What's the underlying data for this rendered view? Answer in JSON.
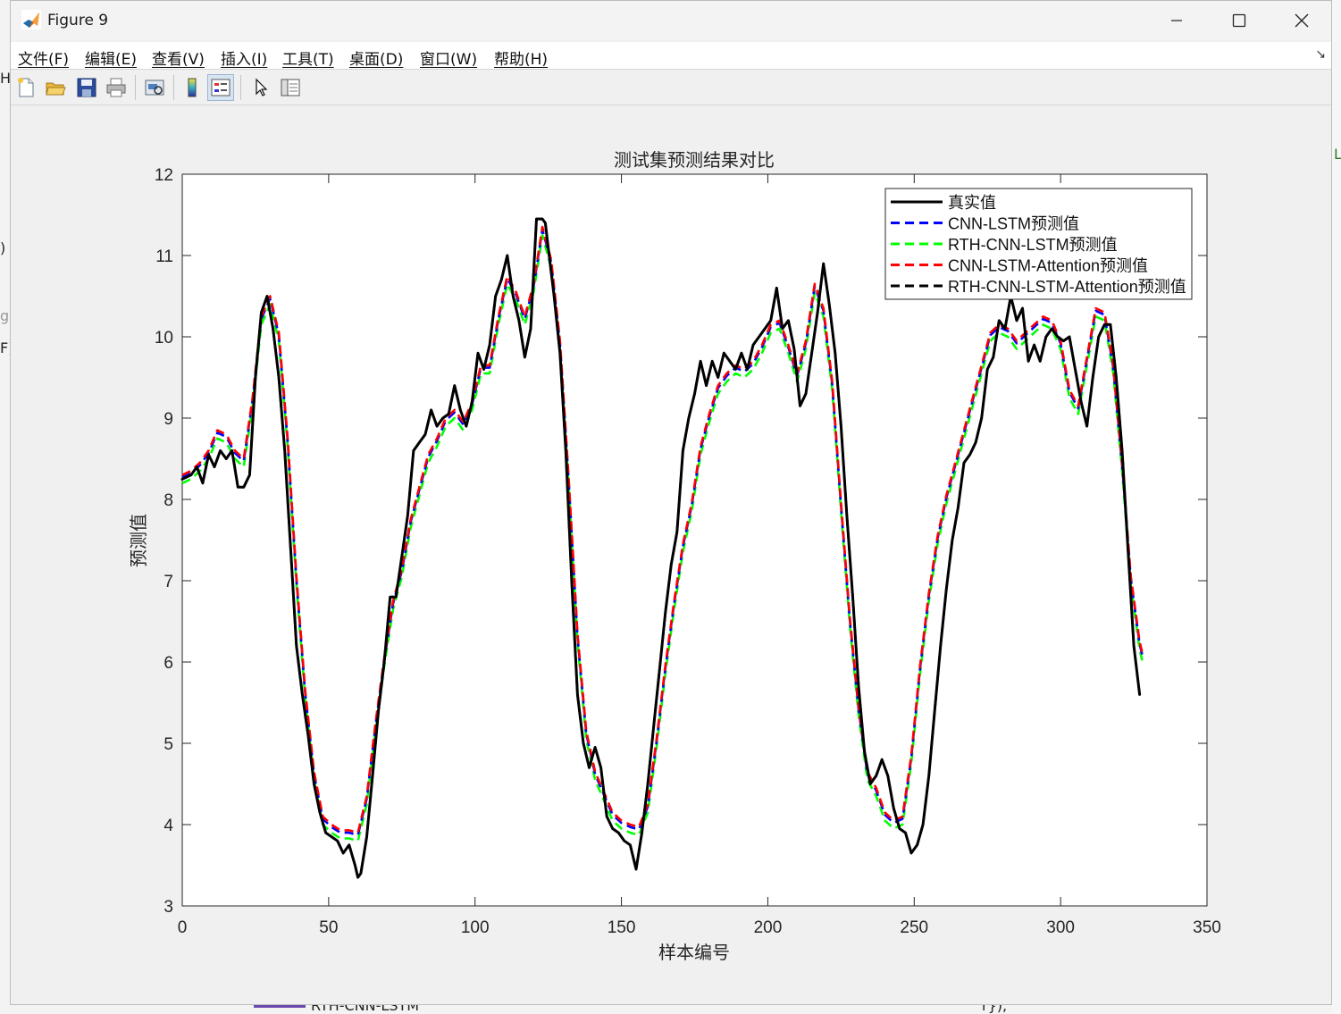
{
  "window": {
    "title": "Figure 9",
    "controls": {
      "minimize": "—",
      "maximize": "☐",
      "close": "✕"
    }
  },
  "menu": [
    {
      "label": "文件(F)"
    },
    {
      "label": "编辑(E)"
    },
    {
      "label": "查看(V)"
    },
    {
      "label": "插入(I)"
    },
    {
      "label": "工具(T)"
    },
    {
      "label": "桌面(D)"
    },
    {
      "label": "窗口(W)"
    },
    {
      "label": "帮助(H)"
    }
  ],
  "menu_arrow": "↘",
  "toolbar": {
    "icons": [
      "new-figure-icon",
      "open-file-icon",
      "save-icon",
      "print-icon",
      "print-preview-icon",
      "insert-colorbar-icon",
      "insert-legend-icon",
      "edit-pointer-icon",
      "property-inspector-icon"
    ]
  },
  "background_fragments": {
    "left": [
      "H",
      ")",
      "g",
      "F)"
    ],
    "right": [
      "Le"
    ],
    "bottom": [
      "RTH-CNN-LSTM",
      "r});"
    ]
  },
  "chart_data": {
    "type": "line",
    "title": "测试集预测结果对比",
    "xlabel": "样本编号",
    "ylabel": "预测值",
    "xlim": [
      0,
      350
    ],
    "ylim": [
      3,
      12
    ],
    "xticks": [
      0,
      50,
      100,
      150,
      200,
      250,
      300,
      350
    ],
    "yticks": [
      3,
      4,
      5,
      6,
      7,
      8,
      9,
      10,
      11,
      12
    ],
    "grid": false,
    "legend_position": "top-right",
    "actual_x": [
      0,
      3,
      5,
      7,
      9,
      11,
      13,
      15,
      17,
      19,
      21,
      23,
      25,
      27,
      29,
      31,
      33,
      35,
      37,
      39,
      41,
      43,
      45,
      47,
      49,
      51,
      53,
      55,
      57,
      59,
      60,
      61,
      63,
      65,
      67,
      69,
      71,
      73,
      75,
      77,
      79,
      81,
      83,
      85,
      87,
      89,
      91,
      93,
      95,
      97,
      99,
      101,
      103,
      105,
      107,
      109,
      111,
      113,
      115,
      117,
      119,
      121,
      123,
      124,
      125,
      127,
      129,
      131,
      133,
      135,
      137,
      139,
      141,
      143,
      145,
      147,
      149,
      151,
      153,
      155,
      157,
      159,
      161,
      163,
      165,
      167,
      169,
      171,
      173,
      175,
      177,
      179,
      181,
      183,
      185,
      187,
      189,
      191,
      193,
      195,
      197,
      199,
      201,
      203,
      205,
      207,
      209,
      211,
      213,
      215,
      217,
      219,
      221,
      223,
      225,
      227,
      229,
      231,
      233,
      235,
      237,
      239,
      241,
      243,
      245,
      247,
      249,
      251,
      253,
      255,
      257,
      259,
      261,
      263,
      265,
      267,
      269,
      271,
      273,
      275,
      277,
      279,
      281,
      283,
      285,
      287,
      289,
      291,
      293,
      295,
      297,
      299,
      301,
      303,
      305,
      307,
      309,
      311,
      313,
      315,
      317,
      319,
      321,
      323,
      325,
      327,
      328
    ],
    "actual_y": [
      8.25,
      8.3,
      8.4,
      8.2,
      8.55,
      8.4,
      8.6,
      8.5,
      8.6,
      8.15,
      8.15,
      8.3,
      9.5,
      10.3,
      10.5,
      10.1,
      9.5,
      8.6,
      7.4,
      6.2,
      5.6,
      5.1,
      4.5,
      4.15,
      3.9,
      3.85,
      3.8,
      3.65,
      3.75,
      3.5,
      3.35,
      3.4,
      3.85,
      4.6,
      5.4,
      6.0,
      6.8,
      6.8,
      7.3,
      7.8,
      8.6,
      8.7,
      8.8,
      9.1,
      8.9,
      9.0,
      9.05,
      9.4,
      9.1,
      8.9,
      9.2,
      9.8,
      9.6,
      9.9,
      10.5,
      10.7,
      11.0,
      10.5,
      10.2,
      9.75,
      10.1,
      11.45,
      11.45,
      11.4,
      11.1,
      10.5,
      9.8,
      8.6,
      7.0,
      5.6,
      5.0,
      4.7,
      4.95,
      4.7,
      4.1,
      3.95,
      3.9,
      3.8,
      3.75,
      3.45,
      3.9,
      4.5,
      5.2,
      5.9,
      6.6,
      7.2,
      7.6,
      8.6,
      9.0,
      9.3,
      9.7,
      9.4,
      9.7,
      9.5,
      9.8,
      9.7,
      9.6,
      9.8,
      9.6,
      9.9,
      10.0,
      10.1,
      10.2,
      10.6,
      10.1,
      10.2,
      9.85,
      9.15,
      9.3,
      9.8,
      10.3,
      10.9,
      10.4,
      9.8,
      8.9,
      7.8,
      6.8,
      5.7,
      4.9,
      4.5,
      4.6,
      4.8,
      4.6,
      4.2,
      3.95,
      3.9,
      3.65,
      3.75,
      4.0,
      4.6,
      5.4,
      6.2,
      6.9,
      7.5,
      7.9,
      8.45,
      8.55,
      8.7,
      9.0,
      9.6,
      9.75,
      10.2,
      10.1,
      10.5,
      10.2,
      10.35,
      9.7,
      9.9,
      9.7,
      10.0,
      10.1,
      10.0,
      9.95,
      10.0,
      9.6,
      9.2,
      8.9,
      9.5,
      10.0,
      10.15,
      10.15,
      9.5,
      8.6,
      7.4,
      6.2,
      5.6
    ],
    "pred_x": [
      0,
      3,
      6,
      9,
      12,
      15,
      18,
      21,
      24,
      27,
      30,
      33,
      36,
      39,
      42,
      45,
      48,
      51,
      54,
      57,
      60,
      63,
      66,
      69,
      72,
      75,
      78,
      81,
      84,
      87,
      90,
      93,
      96,
      99,
      102,
      105,
      108,
      111,
      114,
      117,
      120,
      123,
      126,
      129,
      132,
      135,
      138,
      141,
      144,
      147,
      150,
      153,
      156,
      159,
      162,
      165,
      168,
      171,
      174,
      177,
      180,
      183,
      186,
      189,
      192,
      195,
      198,
      201,
      204,
      207,
      210,
      213,
      216,
      219,
      222,
      225,
      228,
      231,
      234,
      237,
      240,
      243,
      246,
      249,
      252,
      255,
      258,
      261,
      264,
      267,
      270,
      273,
      276,
      279,
      282,
      285,
      288,
      291,
      294,
      297,
      300,
      303,
      306,
      309,
      312,
      315,
      318,
      321,
      324,
      327,
      328
    ],
    "pred_y": [
      8.25,
      8.3,
      8.4,
      8.55,
      8.8,
      8.75,
      8.55,
      8.45,
      9.2,
      10.2,
      10.45,
      10.0,
      8.7,
      7.0,
      5.6,
      4.6,
      4.05,
      3.95,
      3.88,
      3.88,
      3.85,
      4.3,
      5.2,
      6.0,
      6.7,
      7.1,
      7.7,
      8.1,
      8.5,
      8.7,
      8.95,
      9.05,
      8.9,
      9.15,
      9.6,
      9.6,
      10.2,
      10.7,
      10.5,
      10.2,
      10.6,
      11.3,
      10.9,
      9.9,
      8.2,
      6.3,
      5.1,
      4.6,
      4.35,
      4.1,
      4.0,
      3.95,
      3.92,
      4.2,
      5.0,
      5.9,
      6.7,
      7.4,
      7.9,
      8.6,
      9.0,
      9.35,
      9.5,
      9.6,
      9.55,
      9.65,
      9.85,
      10.1,
      10.15,
      9.85,
      9.5,
      9.9,
      10.6,
      10.3,
      9.4,
      7.9,
      6.5,
      5.4,
      4.6,
      4.4,
      4.1,
      4.0,
      4.05,
      4.8,
      5.9,
      6.8,
      7.5,
      8.0,
      8.4,
      8.8,
      9.2,
      9.6,
      10.0,
      10.1,
      10.05,
      9.9,
      10.0,
      10.1,
      10.2,
      10.15,
      9.9,
      9.3,
      9.1,
      9.7,
      10.3,
      10.25,
      9.6,
      8.4,
      7.0,
      6.2,
      6.05
    ],
    "series": [
      {
        "name": "真实值",
        "color": "#000000",
        "style": "solid",
        "source": "actual",
        "offset": 0
      },
      {
        "name": "CNN-LSTM预测值",
        "color": "#0000ff",
        "style": "dashed",
        "source": "pred",
        "offset": 0.02
      },
      {
        "name": "RTH-CNN-LSTM预测值",
        "color": "#00ff00",
        "style": "dashed",
        "source": "pred",
        "offset": -0.05
      },
      {
        "name": "CNN-LSTM-Attention预测值",
        "color": "#ff0000",
        "style": "dashed",
        "source": "pred",
        "offset": 0.05
      },
      {
        "name": "RTH-CNN-LSTM-Attention预测值",
        "color": "#000000",
        "style": "dashed",
        "source": "actual",
        "offset": 0
      }
    ]
  }
}
